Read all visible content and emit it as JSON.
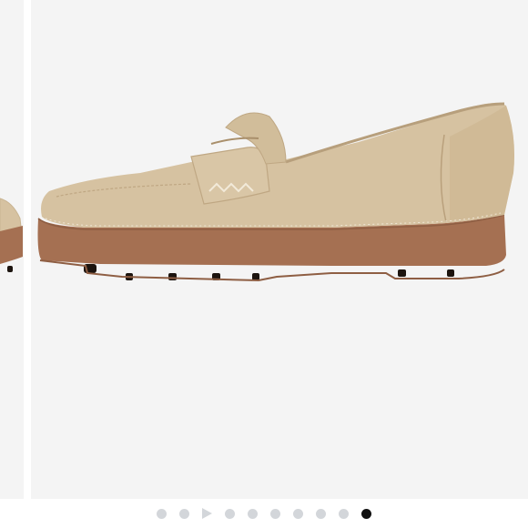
{
  "gallery": {
    "current_index": 11,
    "total": 11,
    "indicators": [
      {
        "kind": "dot",
        "name": "pager-dot-1"
      },
      {
        "kind": "dot",
        "name": "pager-dot-2"
      },
      {
        "kind": "video",
        "name": "pager-video-play-icon"
      },
      {
        "kind": "dot",
        "name": "pager-dot-3"
      },
      {
        "kind": "dot",
        "name": "pager-dot-4"
      },
      {
        "kind": "dot",
        "name": "pager-dot-5"
      },
      {
        "kind": "dot",
        "name": "pager-dot-6"
      },
      {
        "kind": "dot",
        "name": "pager-dot-7"
      },
      {
        "kind": "dot",
        "name": "pager-dot-8"
      },
      {
        "kind": "dot-active",
        "name": "pager-dot-current"
      }
    ]
  },
  "colors": {
    "background": "#f4f4f4",
    "suede": "#d6c2a1",
    "sole": "#a57052",
    "active_dot": "#111111",
    "inactive_dot": "#d3d6da"
  }
}
